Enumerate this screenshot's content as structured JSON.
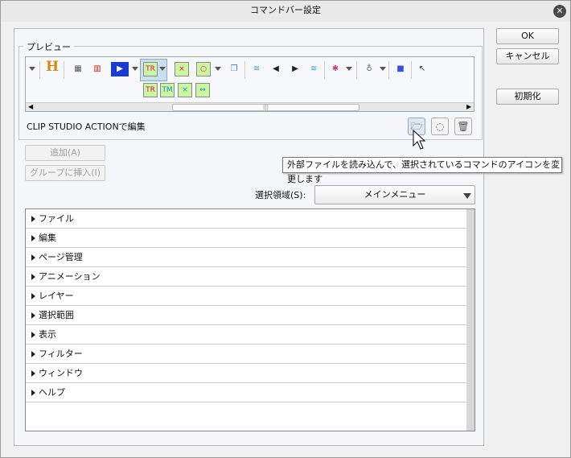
{
  "window": {
    "title": "コマンドバー設定",
    "close_icon": "close-icon"
  },
  "preview": {
    "label": "プレビュー",
    "toolbar_row1": [
      "H",
      "▦",
      "▥",
      "▶",
      "TR",
      "×",
      "○",
      "❐",
      "≋",
      "◀",
      "▶",
      "≋",
      "✱",
      "♁",
      "■",
      "↖"
    ],
    "toolbar_row2": [
      "TR",
      "TM",
      "×",
      "↔"
    ],
    "edit_label": "CLIP STUDIO ACTIONで編集",
    "buttons": {
      "load_icon": "folder-open-icon",
      "reset_icon": "dotted-circle-icon",
      "delete_icon": "trash-icon"
    }
  },
  "tooltip": "外部ファイルを読み込んで、選択されているコマンドのアイコンを変更します",
  "actions": {
    "add": "追加(A)",
    "insert_group": "グループに挿入(I)"
  },
  "selection_area": {
    "label": "選択領域(S):",
    "value": "メインメニュー"
  },
  "tree": [
    "ファイル",
    "編集",
    "ページ管理",
    "アニメーション",
    "レイヤー",
    "選択範囲",
    "表示",
    "フィルター",
    "ウィンドウ",
    "ヘルプ"
  ],
  "side_buttons": {
    "ok": "OK",
    "cancel": "キャンセル",
    "reset": "初期化"
  },
  "colors": {
    "tag_bg": "#ccf5a0",
    "tag_text": "#e0105a",
    "selected_bg": "#c9dff0"
  }
}
